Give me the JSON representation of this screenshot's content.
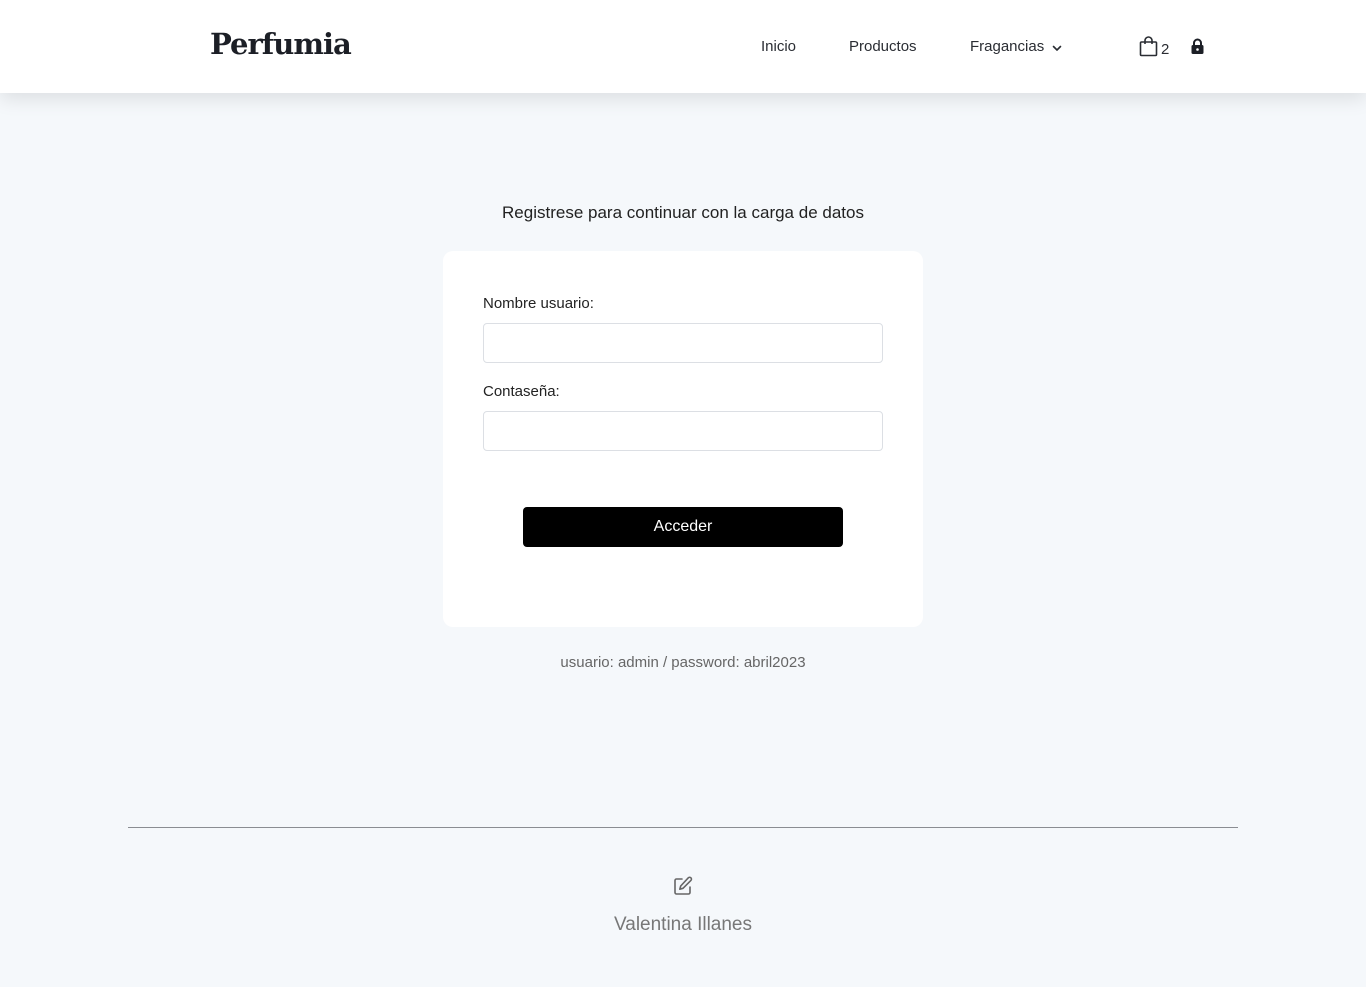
{
  "header": {
    "logo": "Perfumia",
    "nav": {
      "inicio": "Inicio",
      "productos": "Productos",
      "fragancias": "Fragancias"
    },
    "cart_count": "2"
  },
  "main": {
    "intro": "Registrese para continuar con la carga de datos",
    "form": {
      "user_label": "Nombre usuario:",
      "user_value": "",
      "pass_label": "Contaseña:",
      "pass_value": "",
      "submit_label": "Acceder"
    },
    "hint": "usuario: admin / password: abril2023"
  },
  "footer": {
    "author": "Valentina Illanes"
  },
  "colors": {
    "background": "#f5f8fb",
    "button": "#000000",
    "card": "#ffffff"
  },
  "icons": [
    "chevron-down-icon",
    "shopping-bag-icon",
    "lock-icon",
    "edit-icon"
  ]
}
